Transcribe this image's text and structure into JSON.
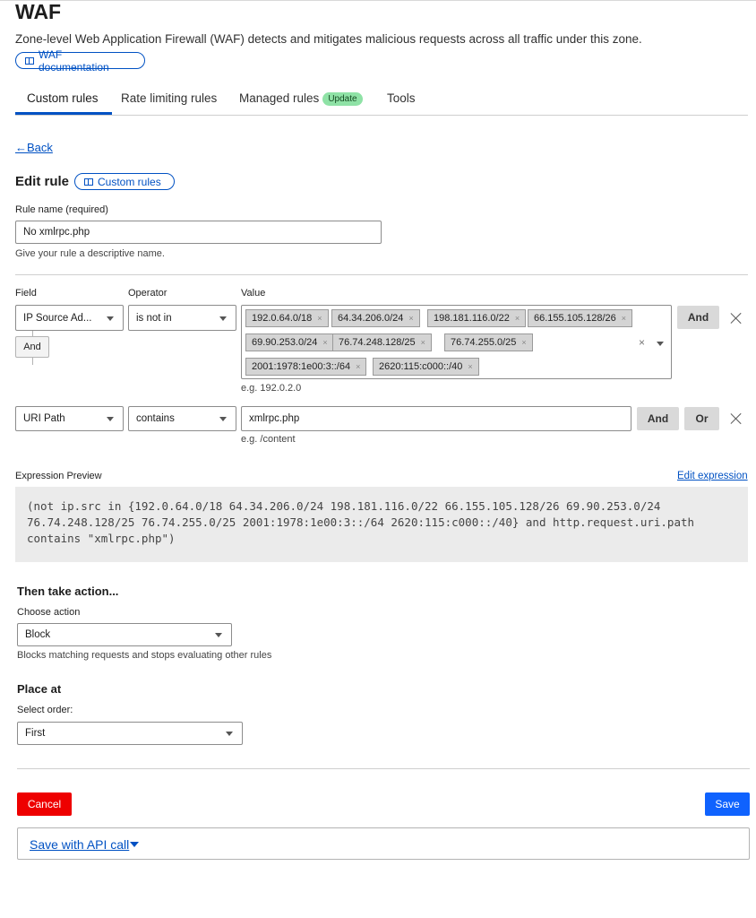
{
  "page": {
    "title": "WAF",
    "description": "Zone-level Web Application Firewall (WAF) detects and mitigates malicious requests across all traffic under this zone.",
    "doc_link": "WAF documentation"
  },
  "tabs": [
    {
      "label": "Custom rules",
      "active": true
    },
    {
      "label": "Rate limiting rules"
    },
    {
      "label": "Managed rules",
      "badge": "Update"
    },
    {
      "label": "Tools"
    }
  ],
  "back_label": "Back",
  "edit": {
    "heading": "Edit rule",
    "doc_link": "Custom rules",
    "rule_name_label": "Rule name (required)",
    "rule_name_value": "No xmlrpc.php",
    "rule_name_help": "Give your rule a descriptive name."
  },
  "columns": {
    "field": "Field",
    "operator": "Operator",
    "value": "Value"
  },
  "conditions": [
    {
      "field": "IP Source Ad...",
      "operator": "is not in",
      "values": [
        "192.0.64.0/18",
        "64.34.206.0/24",
        "198.181.116.0/22",
        "66.155.105.128/26",
        "69.90.253.0/24",
        "76.74.248.128/25",
        "76.74.255.0/25",
        "2001:1978:1e00:3::/64",
        "2620:115:c000::/40"
      ],
      "example": "e.g. 192.0.2.0",
      "and_label": "And"
    },
    {
      "field": "URI Path",
      "operator": "contains",
      "value": "xmlrpc.php",
      "example": "e.g. /content",
      "and_label": "And",
      "or_label": "Or"
    }
  ],
  "connector_label": "And",
  "tag_remove_glyph": "×",
  "expression": {
    "label": "Expression Preview",
    "edit_link": "Edit expression",
    "code": "(not ip.src in {192.0.64.0/18 64.34.206.0/24 198.181.116.0/22 66.155.105.128/26 69.90.253.0/24\n76.74.248.128/25 76.74.255.0/25 2001:1978:1e00:3::/64 2620:115:c000::/40} and http.request.uri.path\ncontains \"xmlrpc.php\")"
  },
  "action": {
    "heading": "Then take action...",
    "label": "Choose action",
    "value": "Block",
    "help": "Blocks matching requests and stops evaluating other rules"
  },
  "place": {
    "heading": "Place at",
    "label": "Select order:",
    "value": "First"
  },
  "footer": {
    "cancel": "Cancel",
    "save": "Save",
    "api_link": "Save with API call"
  },
  "colors": {
    "accent": "#0051c3",
    "danger": "#ee0000",
    "primary": "#0f62fe",
    "badge": "#8fe2a6"
  }
}
